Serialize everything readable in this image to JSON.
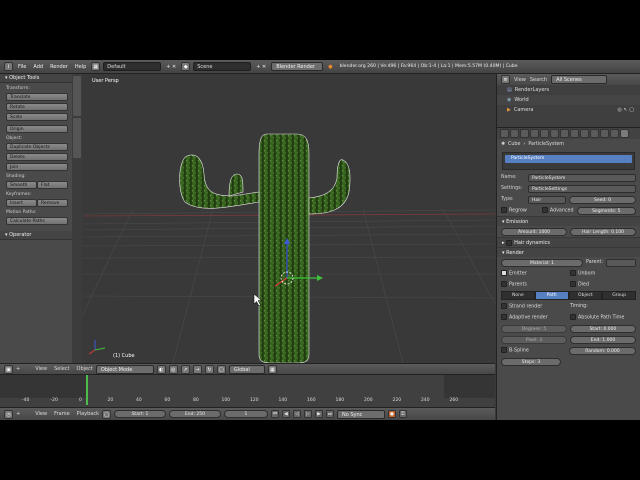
{
  "topbar": {
    "menus": [
      "File",
      "Add",
      "Render",
      "Help"
    ],
    "layout_value": "Default",
    "scene_value": "Scene",
    "engine_value": "Blender Render",
    "info": "blender.org 260 | Ve:496 | Fa:964 | Ob:1-4 | La:1 | Mem:5.57M (0.40M) | Cube"
  },
  "tools": {
    "title": "Object Tools",
    "transform_label": "Transform:",
    "transform_buttons": [
      "Translate",
      "Rotate",
      "Scale"
    ],
    "origin_button": "Origin",
    "object_label": "Object:",
    "object_buttons": [
      "Duplicate Objects",
      "Delete",
      "Join"
    ],
    "shading_label": "Shading:",
    "shading_buttons": [
      "Smooth",
      "Flat"
    ],
    "keyframes_label": "Keyframes:",
    "keyframe_buttons": [
      "Insert",
      "Remove"
    ],
    "motion_label": "Motion Paths:",
    "motion_button": "Calculate Paths",
    "operator_title": "Operator"
  },
  "viewport": {
    "title": "User Persp",
    "object_label": "(1) Cube"
  },
  "viewport_header": {
    "menus": [
      "View",
      "Select",
      "Object"
    ],
    "mode": "Object Mode",
    "orientation": "Global"
  },
  "timeline": {
    "ruler": [
      "-40",
      "-20",
      "0",
      "20",
      "40",
      "60",
      "80",
      "100",
      "120",
      "140",
      "160",
      "180",
      "200",
      "220",
      "240",
      "260"
    ],
    "menus": [
      "View",
      "Frame",
      "Playback"
    ],
    "start": "Start: 1",
    "end": "End: 250",
    "current": "1",
    "sync": "No Sync"
  },
  "outliner": {
    "menus": [
      "View",
      "Search"
    ],
    "filter": "All Scenes",
    "rows": [
      "RenderLayers",
      "World",
      "Camera"
    ]
  },
  "properties": {
    "breadcrumb_obj": "Cube",
    "breadcrumb_sys": "ParticleSystem",
    "slot_name": "ParticleSystem",
    "name_label": "Name:",
    "name_value": "ParticleSystem",
    "settings_label": "Settings:",
    "settings_value": "ParticleSettings",
    "type_label": "Type:",
    "type_value": "Hair",
    "seed_value": "Seed: 0",
    "regrow_label": "Regrow",
    "advanced_label": "Advanced",
    "segments_value": "Segments: 5",
    "emission_title": "Emission",
    "amount_value": "Amount: 1000",
    "hair_length_value": "Hair Length: 0.100",
    "hair_dynamics_label": "Hair dynamics",
    "render_title": "Render",
    "material_value": "Material: 1",
    "parent_label": "Parent:",
    "emitter_label": "Emitter",
    "unborn_label": "Unborn",
    "parents_label": "Parents",
    "died_label": "Died",
    "render_types": [
      "None",
      "Path",
      "Object",
      "Group"
    ],
    "strand_render_label": "Strand render",
    "timing_label": "Timing:",
    "adaptive_render_label": "Adaptive render",
    "abs_path_time_label": "Absolute Path Time",
    "degrees_value": "Degrees: 5",
    "start_value": "Start: 0.000",
    "pixel_value": "Pixel: 3",
    "end_value": "End: 1.000",
    "bspline_label": "B-Spline",
    "random_value": "Random: 0.000",
    "steps_value": "Steps: 3"
  },
  "colors": {
    "selection": "#5680c2",
    "timeline_cursor": "#4cbd4c",
    "cactus": "#3a6b1f"
  }
}
